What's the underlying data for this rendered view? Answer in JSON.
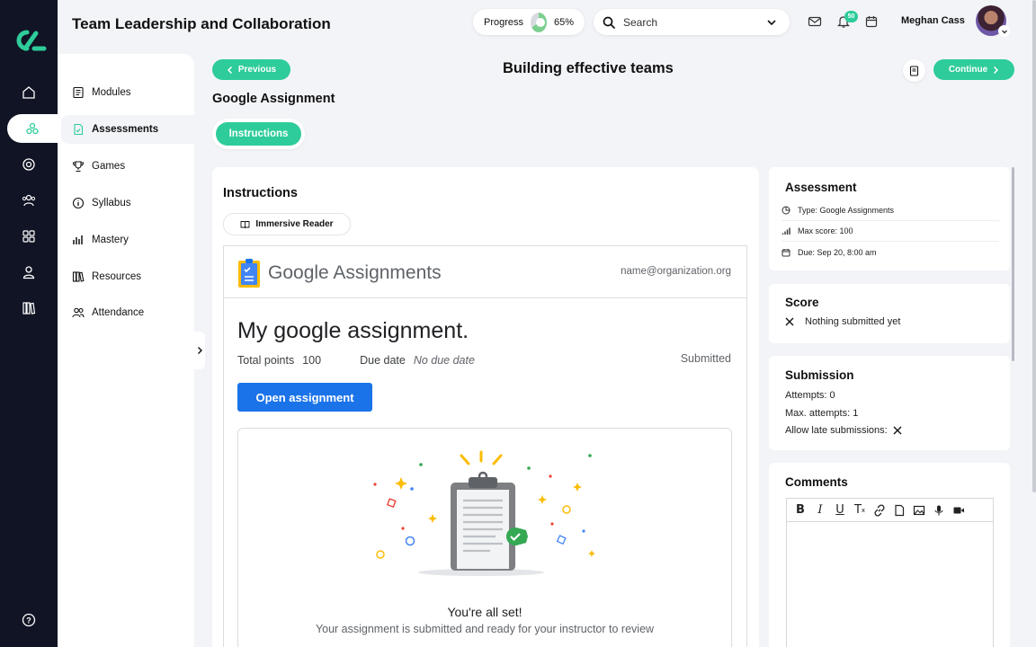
{
  "app": {
    "title": "Team Leadership and Collaboration",
    "accent_color": "#2ecc9a",
    "rail_color": "#101424"
  },
  "header": {
    "progress_label": "Progress",
    "progress_value": "65%",
    "progress_fraction": 0.65,
    "search_placeholder": "Search",
    "notification_count": "50",
    "user_name": "Meghan Cass"
  },
  "rail": {
    "items": [
      "home-icon",
      "modules-hub-icon",
      "target-icon",
      "people-icon",
      "apps-grid-icon",
      "user-icon",
      "library-icon",
      "help-icon"
    ],
    "active": "modules-hub-icon"
  },
  "modnav": {
    "items": [
      {
        "label": "Modules",
        "icon": "modules-icon"
      },
      {
        "label": "Assessments",
        "icon": "assessment-icon"
      },
      {
        "label": "Games",
        "icon": "trophy-icon"
      },
      {
        "label": "Syllabus",
        "icon": "info-icon"
      },
      {
        "label": "Mastery",
        "icon": "chart-icon"
      },
      {
        "label": "Resources",
        "icon": "books-icon"
      },
      {
        "label": "Attendance",
        "icon": "attendance-icon"
      }
    ],
    "active_index": 1
  },
  "topbar": {
    "previous": "Previous",
    "continue": "Continue",
    "page_title": "Building effective teams",
    "sub_title": "Google Assignment",
    "tab": "Instructions"
  },
  "main": {
    "heading": "Instructions",
    "reader_button": "Immersive Reader",
    "gassign": {
      "brand_google": "Google",
      "brand_product": "Assignments",
      "email": "name@organization.org",
      "assignment_title": "My google assignment.",
      "total_points_label": "Total points",
      "total_points_value": "100",
      "due_date_label": "Due date",
      "due_date_value": "No due date",
      "status": "Submitted",
      "open_button": "Open assignment",
      "done_title": "You're all set!",
      "done_sub": "Your assignment is submitted and ready for your instructor to review"
    }
  },
  "assessment": {
    "heading": "Assessment",
    "rows": [
      {
        "icon": "type-icon",
        "text": "Type: Google Assignments"
      },
      {
        "icon": "score-bars-icon",
        "text": "Max score: 100"
      },
      {
        "icon": "calendar-icon",
        "text": "Due: Sep 20, 8:00 am"
      }
    ]
  },
  "score": {
    "heading": "Score",
    "text": "Nothing submitted yet"
  },
  "submission": {
    "heading": "Submission",
    "attempts": "Attempts: 0",
    "max_attempts": "Max. attempts: 1",
    "allow_late": "Allow late submissions:"
  },
  "comments": {
    "heading": "Comments",
    "toolbar": [
      "bold-icon",
      "italic-icon",
      "underline-icon",
      "clear-format-icon",
      "link-icon",
      "file-icon",
      "image-icon",
      "audio-icon",
      "video-icon"
    ]
  }
}
